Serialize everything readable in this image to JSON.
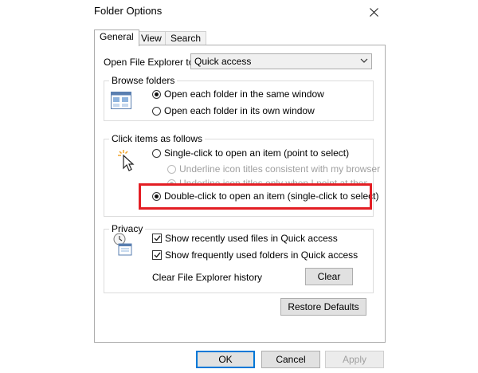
{
  "dialog": {
    "title": "Folder Options"
  },
  "tabs": [
    {
      "label": "General",
      "active": true
    },
    {
      "label": "View"
    },
    {
      "label": "Search"
    }
  ],
  "open_explorer": {
    "label": "Open File Explorer to:",
    "value": "Quick access"
  },
  "browse_folders": {
    "legend": "Browse folders",
    "options": [
      "Open each folder in the same window",
      "Open each folder in its own window"
    ],
    "selected": 0
  },
  "click_items": {
    "legend": "Click items as follows",
    "single": "Single-click to open an item (point to select)",
    "sub1": "Underline icon titles consistent with my browser",
    "sub2": "Underline icon titles only when I point at them",
    "double": "Double-click to open an item (single-click to select)"
  },
  "privacy": {
    "legend": "Privacy",
    "recent_files": "Show recently used files in Quick access",
    "frequent_folders": "Show frequently used folders in Quick access",
    "clear_label": "Clear File Explorer history",
    "clear_button": "Clear"
  },
  "restore_defaults": "Restore Defaults",
  "footer": {
    "ok": "OK",
    "cancel": "Cancel",
    "apply": "Apply"
  },
  "colors": {
    "highlight": "#e31e24",
    "focus": "#0078d7"
  }
}
